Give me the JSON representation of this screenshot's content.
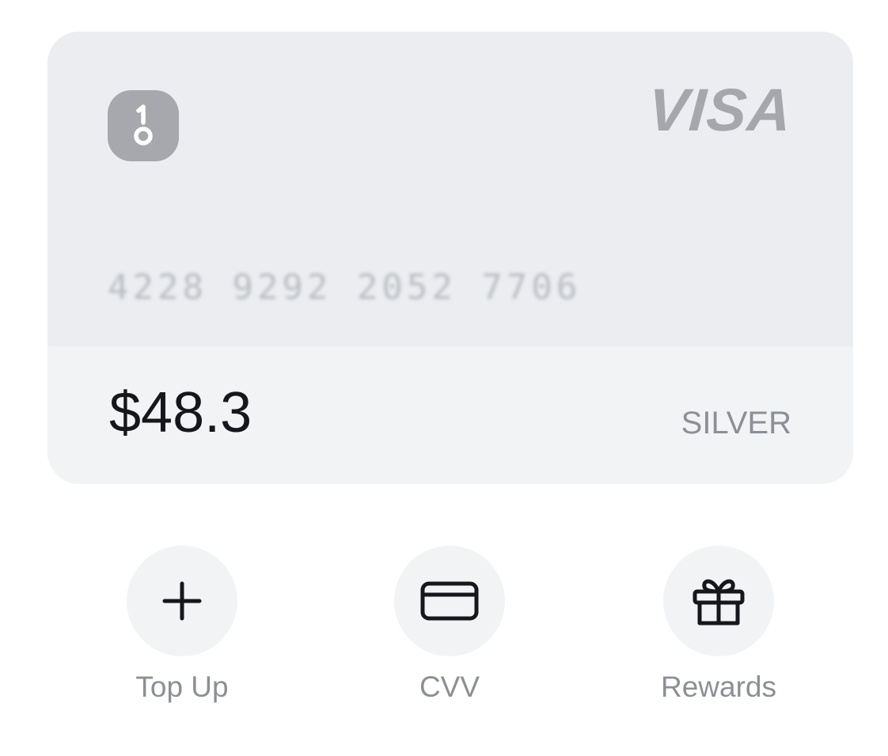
{
  "card": {
    "network": "VISA",
    "number": "4228 9292 2052 7706",
    "balance": "$48.3",
    "tier": "SILVER",
    "brand_logo_icon": "one-key-icon"
  },
  "actions": [
    {
      "label": "Top Up",
      "icon": "plus-icon"
    },
    {
      "label": "CVV",
      "icon": "credit-card-icon"
    },
    {
      "label": "Rewards",
      "icon": "gift-icon"
    }
  ],
  "colors": {
    "card_background": "#ebedf0",
    "action_background": "#f2f3f5",
    "icon_stroke": "#15171c",
    "muted_text": "#8c8f95"
  }
}
